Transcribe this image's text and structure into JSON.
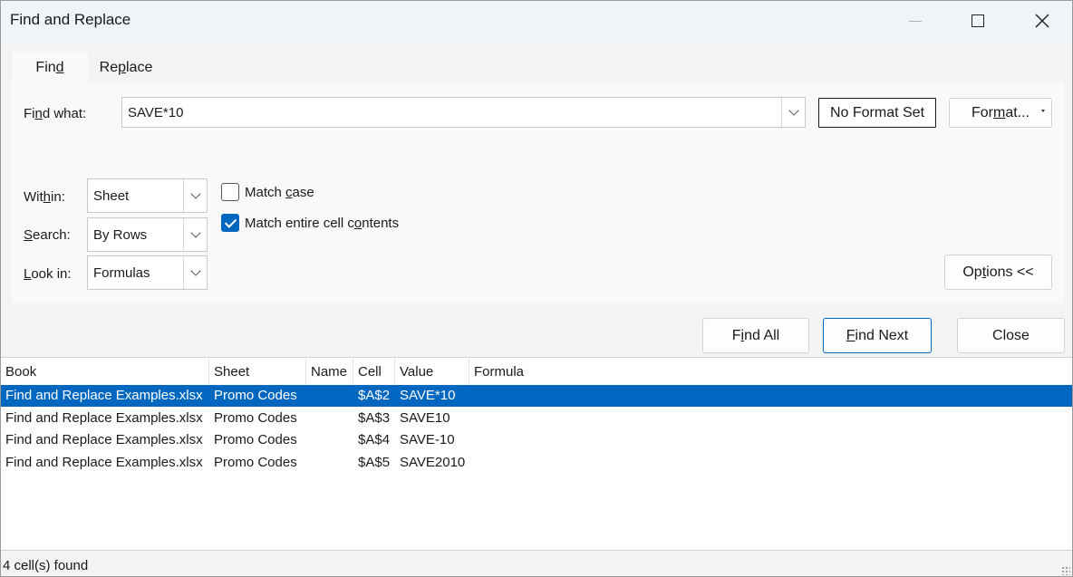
{
  "window": {
    "title": "Find and Replace"
  },
  "tabs": [
    {
      "pre": "Fin",
      "key": "d",
      "post": ""
    },
    {
      "pre": "Re",
      "key": "p",
      "post": "lace"
    }
  ],
  "find": {
    "label_pre": "Fi",
    "label_key": "n",
    "label_post": "d what:",
    "value": "SAVE*10",
    "no_format": "No Format Set",
    "format_pre": "For",
    "format_key": "m",
    "format_post": "at..."
  },
  "options": {
    "within": {
      "label_pre": "Wit",
      "label_key": "h",
      "label_post": "in:",
      "value": "Sheet"
    },
    "search": {
      "label_pre": "",
      "label_key": "S",
      "label_post": "earch:",
      "value": "By Rows"
    },
    "lookin": {
      "label_pre": "",
      "label_key": "L",
      "label_post": "ook in:",
      "value": "Formulas"
    },
    "match_case": {
      "pre": "Match ",
      "key": "c",
      "post": "ase",
      "checked": false
    },
    "match_entire": {
      "pre": "Match entire cell c",
      "key": "o",
      "post": "ntents",
      "checked": true
    },
    "options_btn": {
      "pre": "Op",
      "key": "t",
      "post": "ions <<"
    }
  },
  "buttons": {
    "find_all": {
      "pre": "F",
      "key": "i",
      "post": "nd All"
    },
    "find_next": {
      "pre": "",
      "key": "F",
      "post": "ind Next"
    },
    "close": "Close"
  },
  "results": {
    "columns": [
      "Book",
      "Sheet",
      "Name",
      "Cell",
      "Value",
      "Formula"
    ],
    "rows": [
      {
        "book": "Find and Replace Examples.xlsx",
        "sheet": "Promo Codes",
        "name": "",
        "cell": "$A$2",
        "value": "SAVE*10",
        "formula": "",
        "selected": true
      },
      {
        "book": "Find and Replace Examples.xlsx",
        "sheet": "Promo Codes",
        "name": "",
        "cell": "$A$3",
        "value": "SAVE10",
        "formula": ""
      },
      {
        "book": "Find and Replace Examples.xlsx",
        "sheet": "Promo Codes",
        "name": "",
        "cell": "$A$4",
        "value": "SAVE-10",
        "formula": ""
      },
      {
        "book": "Find and Replace Examples.xlsx",
        "sheet": "Promo Codes",
        "name": "",
        "cell": "$A$5",
        "value": "SAVE2010",
        "formula": ""
      }
    ]
  },
  "status": "4 cell(s) found",
  "colors": {
    "accent": "#0067c0",
    "selection": "#0067c0",
    "titlebar": "#eef4f8"
  },
  "icons": [
    "minimize-icon",
    "maximize-icon",
    "close-icon",
    "chevron-down-icon",
    "checkmark-icon",
    "resize-grip-icon"
  ]
}
